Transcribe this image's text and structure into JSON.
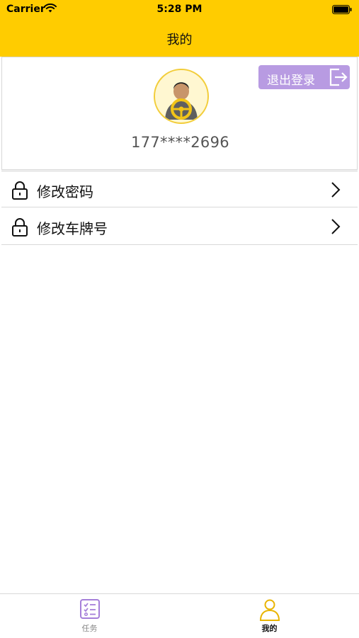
{
  "status_bar": {
    "carrier": "Carrier",
    "time": "5:28 PM"
  },
  "nav": {
    "title": "我的"
  },
  "profile": {
    "phone": "177****2696",
    "logout_label": "退出登录"
  },
  "menu": [
    {
      "label": "修改密码",
      "icon": "lock-icon"
    },
    {
      "label": "修改车牌号",
      "icon": "lock-icon"
    }
  ],
  "tabs": [
    {
      "label": "任务",
      "icon": "task-list-icon",
      "selected": false
    },
    {
      "label": "我的",
      "icon": "person-icon",
      "selected": true
    }
  ],
  "colors": {
    "accent": "#FFCC00",
    "logout": "#B89BE2",
    "tab_task": "#A57FD9",
    "tab_mine": "#E9B400"
  }
}
